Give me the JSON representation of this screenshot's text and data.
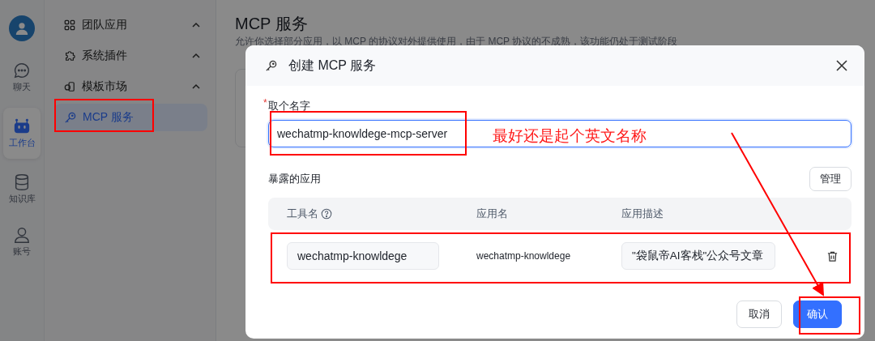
{
  "rail": {
    "items": [
      {
        "label": "聊天",
        "selected": false
      },
      {
        "label": "工作台",
        "selected": true
      },
      {
        "label": "知识库",
        "selected": false
      },
      {
        "label": "账号",
        "selected": false
      }
    ]
  },
  "sidebar": {
    "items": [
      {
        "label": "团队应用",
        "expanded": true,
        "selected": false
      },
      {
        "label": "系统插件",
        "expanded": true,
        "selected": false
      },
      {
        "label": "模板市场",
        "expanded": true,
        "selected": false
      },
      {
        "label": "MCP 服务",
        "selected": true
      }
    ]
  },
  "page": {
    "title": "MCP 服务",
    "subtitle": "允许你选择部分应用，以 MCP 的协议对外提供使用，由于 MCP 协议的不成熟，该功能仍处于测试阶段"
  },
  "dialog": {
    "title": "创建 MCP 服务",
    "name_field": {
      "label": "取个名字",
      "required_mark": "*",
      "value": "wechatmp-knowldege-mcp-server",
      "focused": true
    },
    "section_title": "暴露的应用",
    "manage_button": "管理",
    "table": {
      "columns": [
        "工具名",
        "应用名",
        "应用描述"
      ],
      "rows": [
        {
          "tool_name": "wechatmp-knowldege",
          "app_name": "wechatmp-knowldege",
          "description": "\"袋鼠帝AI客栈\"公众号文章"
        }
      ]
    },
    "buttons": [
      {
        "label": "取消",
        "kind": "secondary"
      },
      {
        "label": "确认",
        "kind": "primary"
      }
    ]
  },
  "annotation": {
    "note": "最好还是起个英文名称"
  }
}
